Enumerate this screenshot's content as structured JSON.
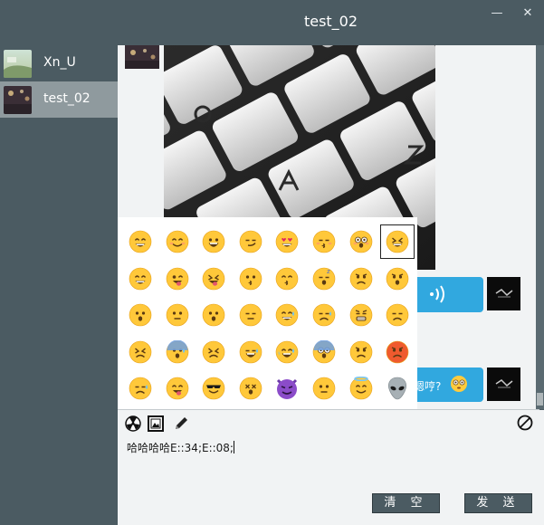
{
  "window": {
    "title": "test_02",
    "minimize_glyph": "—",
    "close_glyph": "✕"
  },
  "sidebar": {
    "items": [
      {
        "name": "Xn_U",
        "selected": false
      },
      {
        "name": "test_02",
        "selected": true
      }
    ]
  },
  "chat": {
    "voice_bubble_icon": "sound-wave-icon",
    "text_bubble": {
      "text": "嗯哼?"
    }
  },
  "emoji_panel": {
    "selected_index": 7,
    "icons": [
      "grinning-face-icon",
      "smiling-face-icon",
      "big-smile-face-icon",
      "smirking-face-icon",
      "heart-eyes-face-icon",
      "kissing-closed-eyes-face-icon",
      "flushed-face-icon",
      "laughing-squint-face-icon",
      "grin-face-icon",
      "winking-tongue-face-icon",
      "squint-tongue-face-icon",
      "kissing-face-icon",
      "kissing-smiling-eyes-face-icon",
      "sleeping-face-icon",
      "worried-face-icon",
      "frowning-open-face-icon",
      "open-mouth-face-icon",
      "confused-face-icon",
      "hushed-face-icon",
      "unamused-face-icon",
      "sweat-smile-face-icon",
      "disappointed-relieved-face-icon",
      "weary-face-icon",
      "disappointed-face-icon",
      "confounded-face-icon",
      "anxious-sweat-face-icon",
      "tired-face-icon",
      "crying-face-icon",
      "tears-of-joy-face-icon",
      "scream-face-icon",
      "angry-face-icon",
      "pouting-face-icon",
      "sleepy-face-icon",
      "yum-face-icon",
      "sunglasses-face-icon",
      "dizzy-face-icon",
      "smiling-imp-icon",
      "neutral-face-icon",
      "halo-face-icon",
      "alien-icon"
    ]
  },
  "toolbar": {
    "icons": [
      "radioactive-icon",
      "picture-frame-icon",
      "pen-icon",
      "block-icon"
    ]
  },
  "editor": {
    "value": "哈哈哈哈E::34;E::08;"
  },
  "buttons": {
    "clear_label": "清 空",
    "send_label": "发 送"
  }
}
